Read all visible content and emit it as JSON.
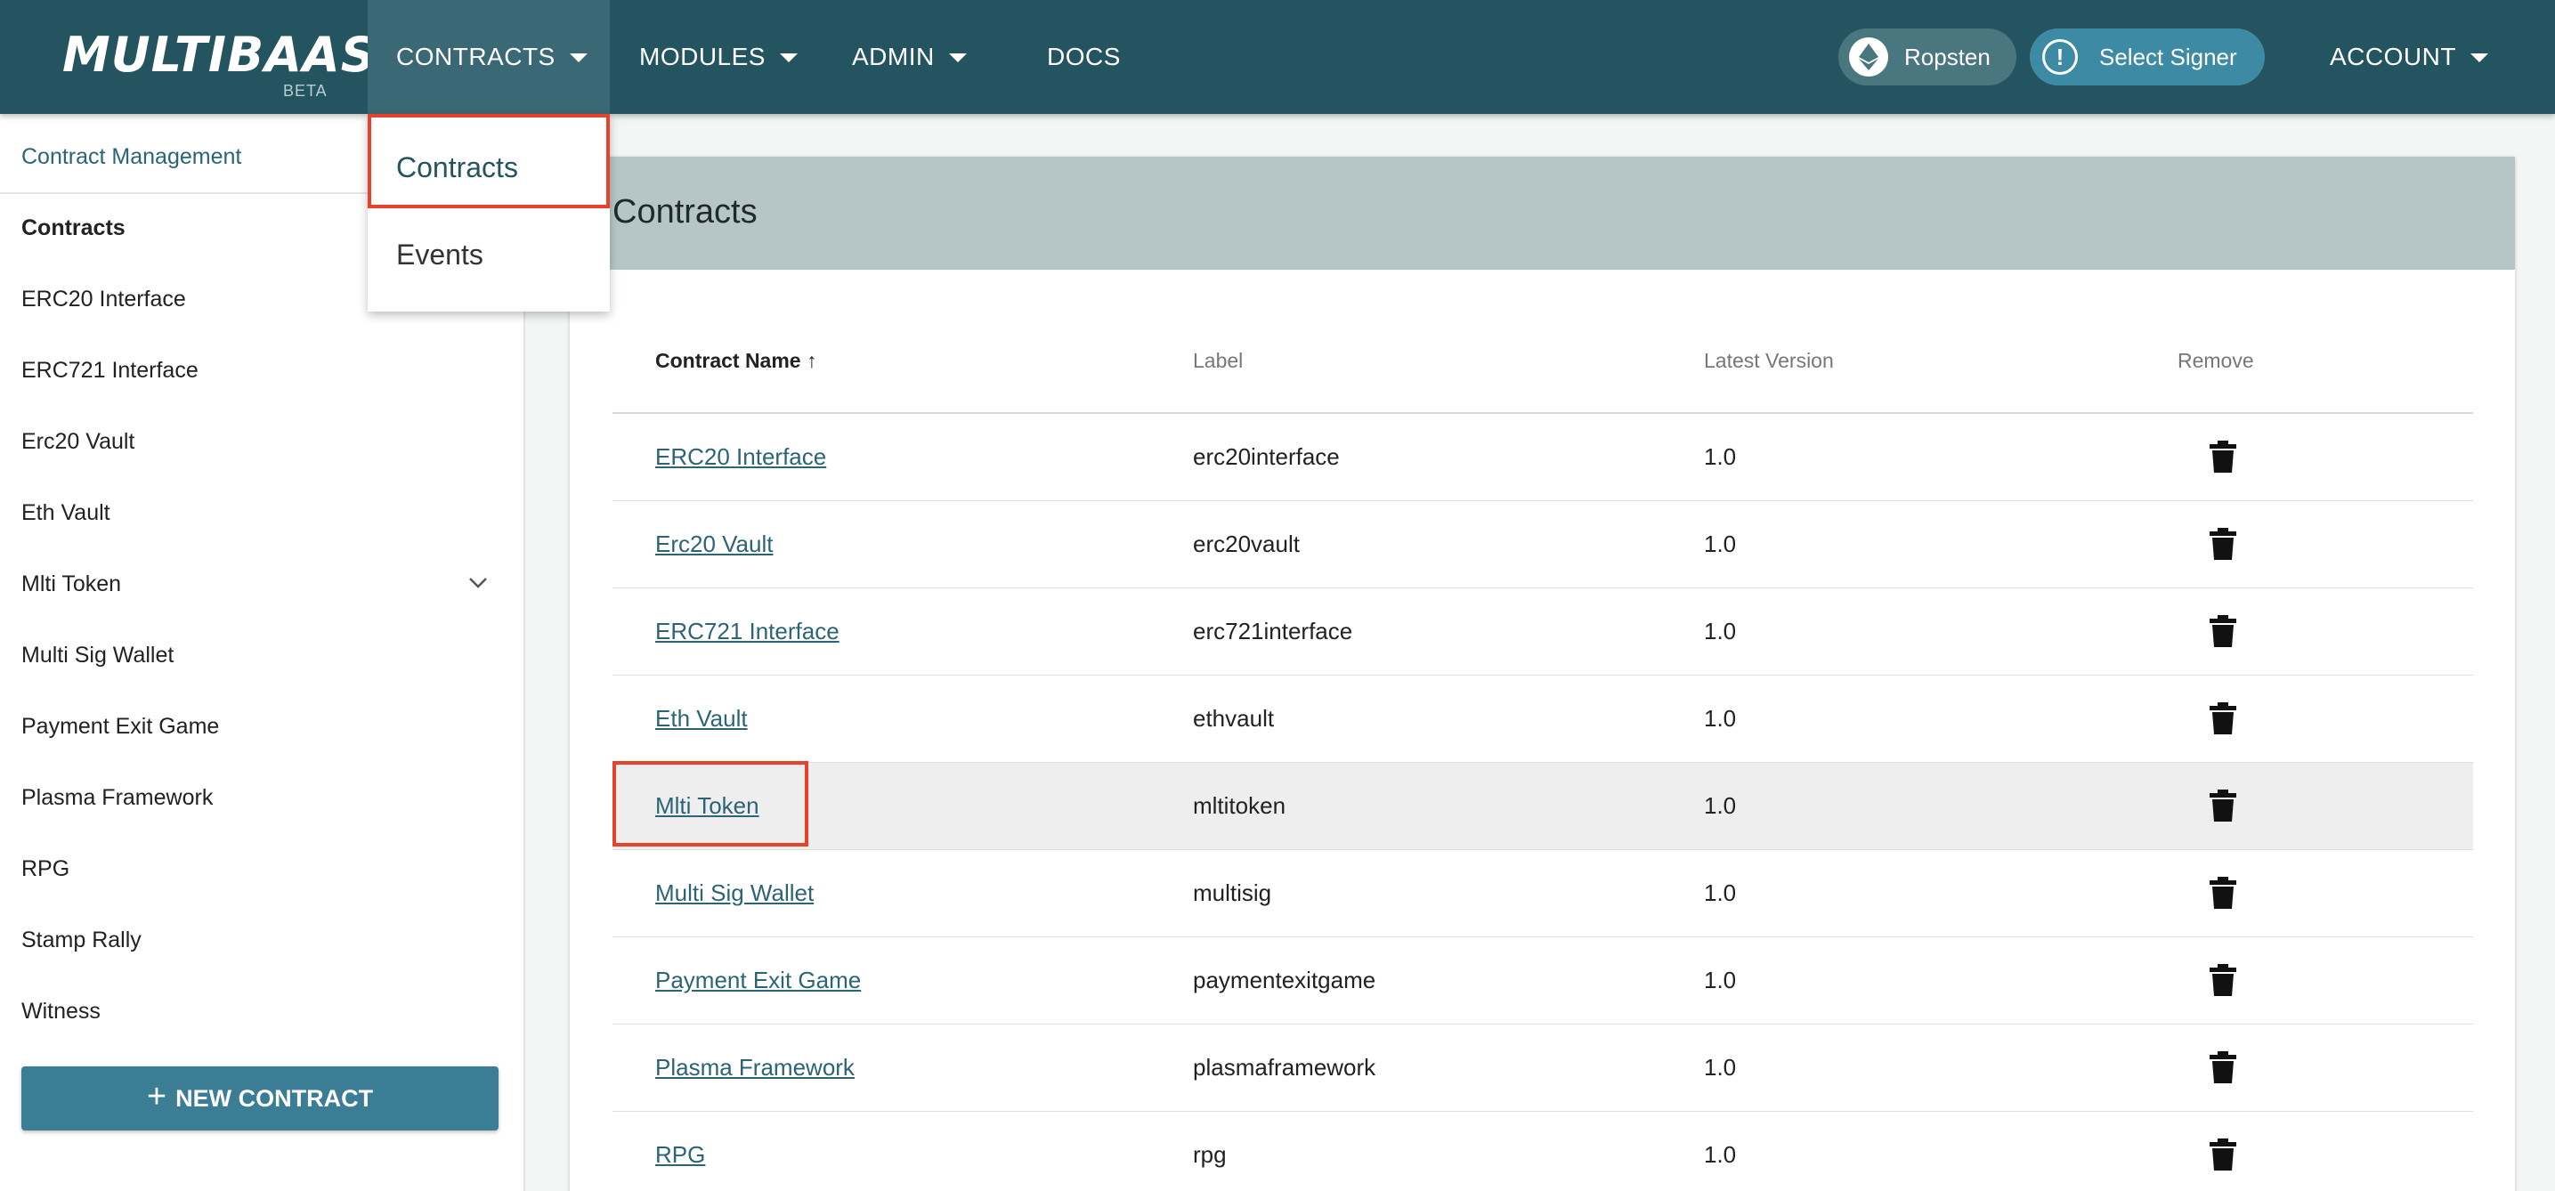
{
  "brand": {
    "logo": "MULTIBAAS",
    "beta": "BETA"
  },
  "nav": {
    "contracts": "CONTRACTS",
    "modules": "MODULES",
    "admin": "ADMIN",
    "docs": "DOCS",
    "network": "Ropsten",
    "signer": "Select Signer",
    "account": "ACCOUNT"
  },
  "dropdown": {
    "items": [
      "Contracts",
      "Events"
    ]
  },
  "sidebar": {
    "heading": "Contract Management",
    "items": [
      "Contracts",
      "ERC20 Interface",
      "ERC721 Interface",
      "Erc20 Vault",
      "Eth Vault",
      "Mlti Token",
      "Multi Sig Wallet",
      "Payment Exit Game",
      "Plasma Framework",
      "RPG",
      "Stamp Rally",
      "Witness"
    ],
    "new_button": "NEW CONTRACT"
  },
  "main": {
    "title": "Contracts",
    "columns": {
      "name": "Contract Name",
      "label": "Label",
      "version": "Latest Version",
      "remove": "Remove"
    },
    "sort_indicator": "↑",
    "rows": [
      {
        "name": "ERC20 Interface",
        "label": "erc20interface",
        "version": "1.0"
      },
      {
        "name": "Erc20 Vault",
        "label": "erc20vault",
        "version": "1.0"
      },
      {
        "name": "ERC721 Interface",
        "label": "erc721interface",
        "version": "1.0"
      },
      {
        "name": "Eth Vault",
        "label": "ethvault",
        "version": "1.0"
      },
      {
        "name": "Mlti Token",
        "label": "mltitoken",
        "version": "1.0"
      },
      {
        "name": "Multi Sig Wallet",
        "label": "multisig",
        "version": "1.0"
      },
      {
        "name": "Payment Exit Game",
        "label": "paymentexitgame",
        "version": "1.0"
      },
      {
        "name": "Plasma Framework",
        "label": "plasmaframework",
        "version": "1.0"
      },
      {
        "name": "RPG",
        "label": "rpg",
        "version": "1.0"
      }
    ]
  },
  "colors": {
    "topbar": "#245460",
    "accent": "#3a7d94",
    "highlight": "#e8412c",
    "link": "#2b6475"
  },
  "icons": {
    "network": "ethereum-icon",
    "signer": "alert-icon",
    "remove": "trash-icon"
  }
}
